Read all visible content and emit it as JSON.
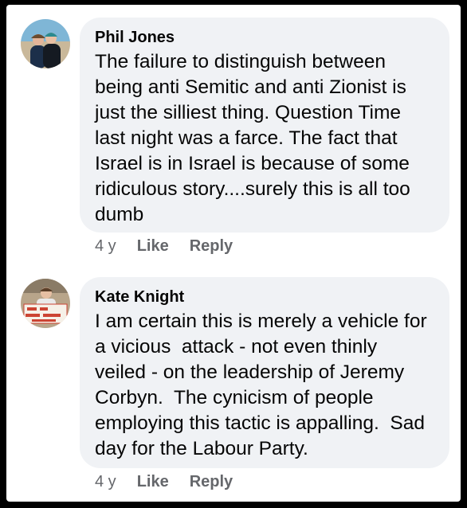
{
  "comments": [
    {
      "author": "Phil Jones",
      "text": "The failure to distinguish between\nbeing anti Semitic and anti Zionist is\njust the silliest thing. Question Time\nlast night was a farce. The fact that\nIsrael is in Israel is because of some\nridiculous story....surely this is all too\ndumb",
      "time": "4 y",
      "like_label": "Like",
      "reply_label": "Reply"
    },
    {
      "author": "Kate Knight",
      "text": "I am certain this is merely a vehicle for\na vicious  attack - not even thinly\nveiled - on the leadership of Jeremy\nCorbyn.  The cynicism of people\nemploying this tactic is appalling.  Sad\nday for the Labour Party.",
      "time": "4 y",
      "like_label": "Like",
      "reply_label": "Reply"
    }
  ],
  "colors": {
    "bubble": "#f0f2f5",
    "text": "#050505",
    "meta": "#65676b",
    "background": "#000000"
  },
  "icons": {
    "avatar_1": "profile-photo-two-people",
    "avatar_2": "profile-photo-person-with-banner"
  }
}
